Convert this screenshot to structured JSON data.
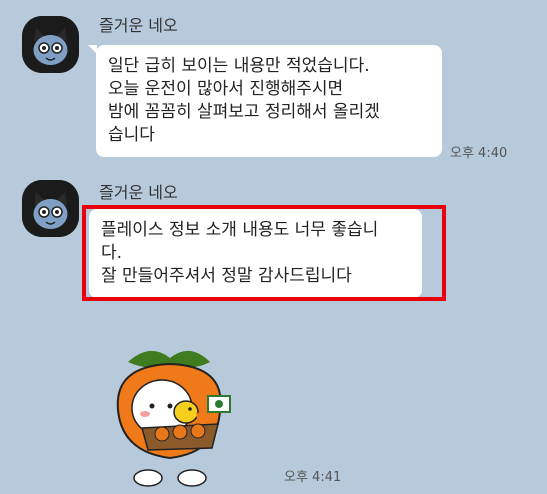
{
  "messages": [
    {
      "sender": "즐거운 네오",
      "lines": [
        "일단 급히 보이는 내용만 적었습니다.",
        "오늘 운전이 많아서 진행해주시면",
        "밤에 꼼꼼히 살펴보고 정리해서 올리겠",
        "습니다"
      ],
      "time": "오후 4:40"
    },
    {
      "sender": "즐거운 네오",
      "lines": [
        "플레이스 정보 소개 내용도 너무 좋습니",
        "다.",
        "잘 만들어주셔서 정말 감사드립니다"
      ],
      "highlighted": true
    }
  ],
  "sticker": {
    "icon": "persimmon-character-sticker",
    "time": "오후 4:41"
  },
  "colors": {
    "background": "#b7cadb",
    "bubble": "#ffffff",
    "highlight": "#e8000c"
  }
}
